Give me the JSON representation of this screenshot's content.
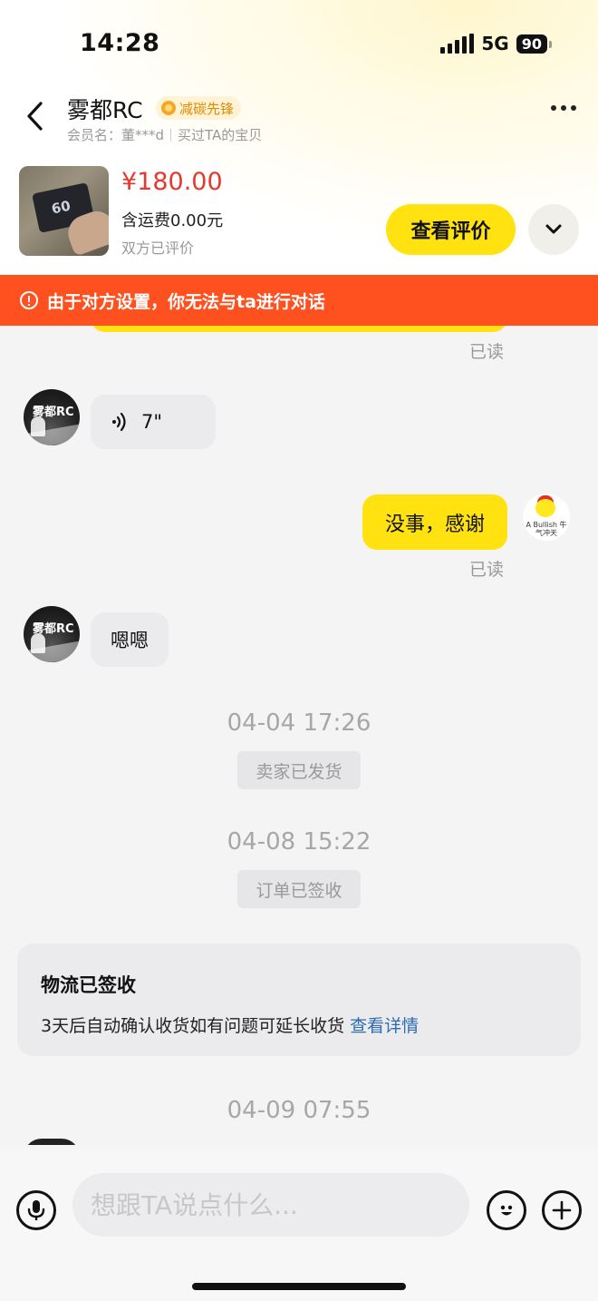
{
  "status_bar": {
    "time": "14:28",
    "network": "5G",
    "battery": "90"
  },
  "header": {
    "shop_name": "雾都RC",
    "badge": "减碳先锋",
    "member_name": "会员名：董***d",
    "purchase_note": "买过TA的宝贝"
  },
  "product": {
    "price": "¥180.00",
    "shipping": "含运费0.00元",
    "review_status": "双方已评价",
    "review_button": "查看评价"
  },
  "warning": {
    "text": "由于对方设置，你无法与ta进行对话"
  },
  "messages": {
    "read_label_1": "已读",
    "voice_duration": "7\"",
    "my_message": "没事，感谢",
    "read_label_2": "已读",
    "seller_reply": "嗯嗯",
    "seller_avatar_text": "雾都RC",
    "my_avatar_caption": "A Bullish 牛气冲天"
  },
  "timeline": {
    "time_1": "04-04 17:26",
    "note_1": "卖家已发货",
    "time_2": "04-08 15:22",
    "note_2": "订单已签收",
    "time_3": "04-09 07:55"
  },
  "logistics": {
    "title": "物流已签收",
    "description": "3天后自动确认收货如有问题可延长收货",
    "link": "查看详情"
  },
  "input_bar": {
    "placeholder": "想跟TA说点什么..."
  },
  "colors": {
    "accent_yellow": "#ffe20f",
    "warning_orange": "#ff5120",
    "price_red": "#e8382d",
    "link_blue": "#2d6bb2"
  }
}
